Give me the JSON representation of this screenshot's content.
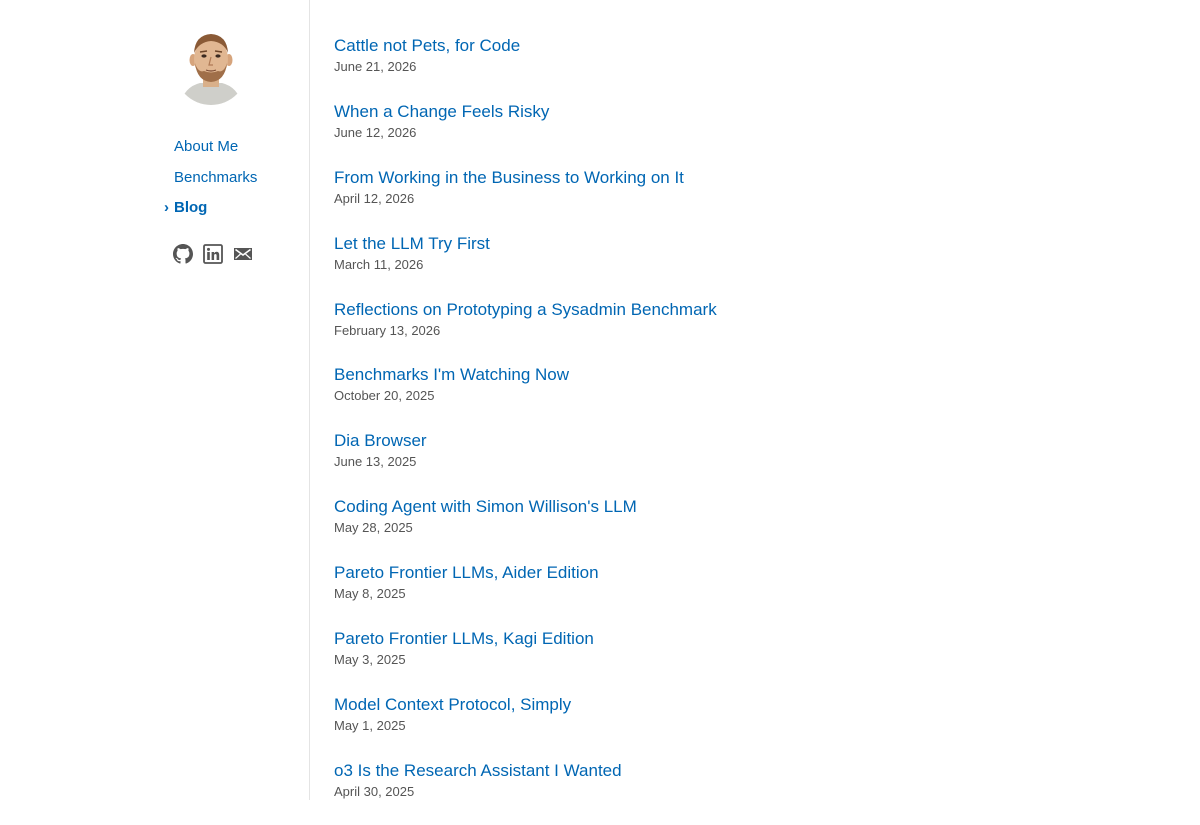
{
  "sidebar": {
    "avatar": "avatar",
    "nav": [
      {
        "label": "About Me",
        "active": false
      },
      {
        "label": "Benchmarks",
        "active": false
      },
      {
        "label": "Blog",
        "active": true,
        "marker": "›"
      }
    ],
    "social": [
      {
        "icon": "github-icon"
      },
      {
        "icon": "linkedin-icon"
      },
      {
        "icon": "email-icon"
      }
    ]
  },
  "posts": [
    {
      "title": "Cattle not Pets, for Code",
      "date": "June 21, 2026"
    },
    {
      "title": "When a Change Feels Risky",
      "date": "June 12, 2026"
    },
    {
      "title": "From Working in the Business to Working on It",
      "date": "April 12, 2026"
    },
    {
      "title": "Let the LLM Try First",
      "date": "March 11, 2026"
    },
    {
      "title": "Reflections on Prototyping a Sysadmin Benchmark",
      "date": "February 13, 2026"
    },
    {
      "title": "Benchmarks I'm Watching Now",
      "date": "October 20, 2025"
    },
    {
      "title": "Dia Browser",
      "date": "June 13, 2025"
    },
    {
      "title": "Coding Agent with Simon Willison's LLM",
      "date": "May 28, 2025"
    },
    {
      "title": "Pareto Frontier LLMs, Aider Edition",
      "date": "May 8, 2025"
    },
    {
      "title": "Pareto Frontier LLMs, Kagi Edition",
      "date": "May 3, 2025"
    },
    {
      "title": "Model Context Protocol, Simply",
      "date": "May 1, 2025"
    },
    {
      "title": "o3 Is the Research Assistant I Wanted",
      "date": "April 30, 2025"
    }
  ],
  "colors": {
    "link": "#0066b3",
    "date": "#555555",
    "icon": "#555555",
    "divider": "#e4e4e4"
  }
}
